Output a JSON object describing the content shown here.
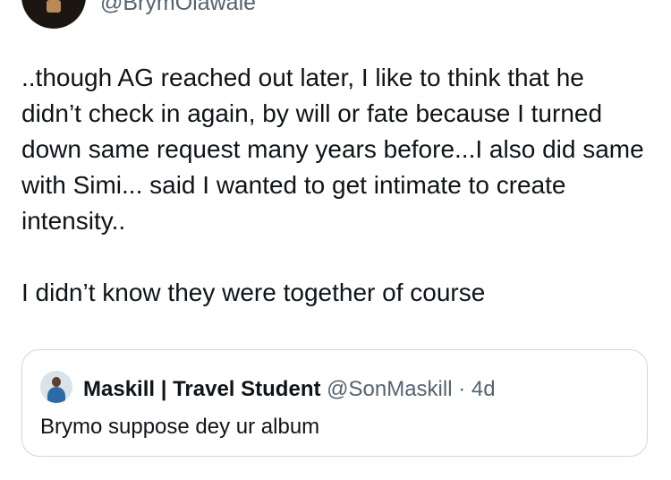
{
  "author": {
    "handle": "@BrymOlawale"
  },
  "tweet": {
    "text": "..though AG reached out later, I like to think that he didn’t check in again, by will or fate because I turned down same request many years before...I also did same with Simi... said I wanted to get intimate to create intensity..\n\nI didn’t know they were together of course"
  },
  "quote": {
    "author_name": "Maskill | Travel Student",
    "author_handle": "@SonMaskill",
    "separator": "·",
    "time": "4d",
    "text": "Brymo suppose dey ur album"
  }
}
